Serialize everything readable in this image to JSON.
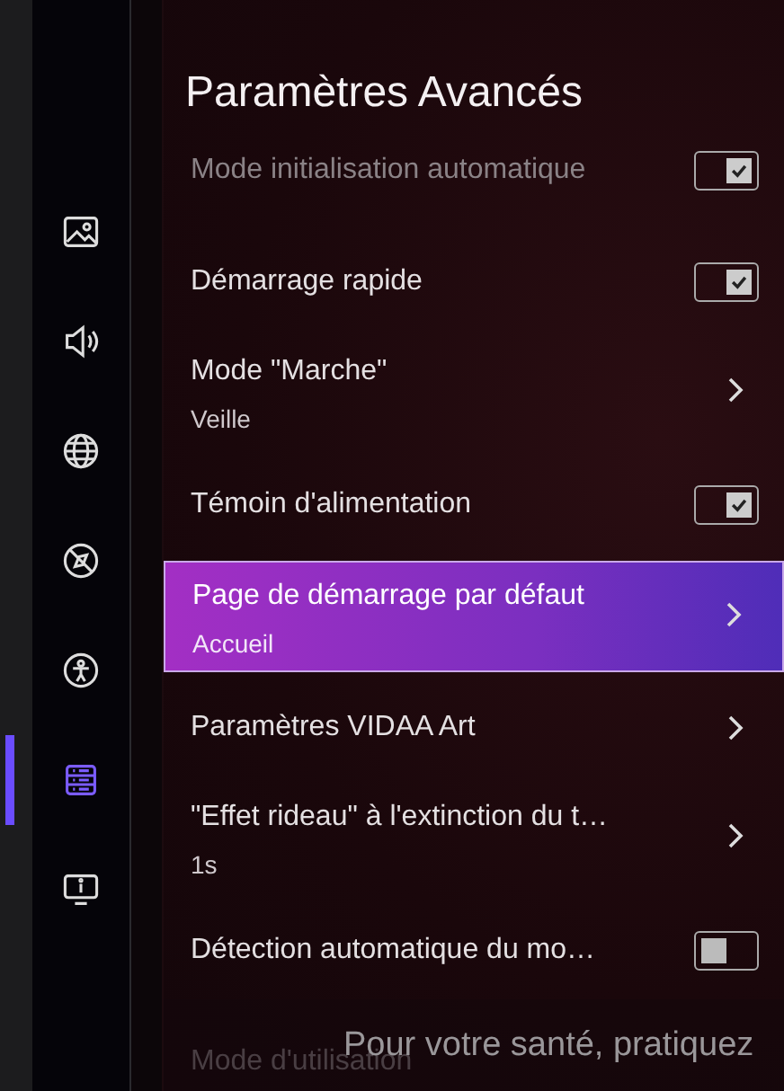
{
  "title": "Paramètres Avancés",
  "sidebar": [
    {
      "kind": "picture",
      "selected": false
    },
    {
      "kind": "sound",
      "selected": false
    },
    {
      "kind": "globe",
      "selected": false
    },
    {
      "kind": "block",
      "selected": false
    },
    {
      "kind": "person",
      "selected": false
    },
    {
      "kind": "list",
      "selected": true
    },
    {
      "kind": "monitor",
      "selected": false
    }
  ],
  "rows": [
    {
      "kind": "checkbox",
      "label": "Mode initialisation automatique",
      "checked": true,
      "dimmed": true,
      "selected": false
    },
    {
      "kind": "checkbox",
      "label": "Démarrage rapide",
      "checked": true,
      "dimmed": false,
      "selected": false
    },
    {
      "kind": "submenu",
      "label": "Mode \"Marche\"",
      "value": "Veille",
      "dimmed": false,
      "selected": false
    },
    {
      "kind": "checkbox",
      "label": "Témoin d'alimentation",
      "checked": true,
      "dimmed": false,
      "selected": false
    },
    {
      "kind": "submenu",
      "label": "Page de démarrage par défaut",
      "value": "Accueil",
      "dimmed": false,
      "selected": true
    },
    {
      "kind": "submenu",
      "label": "Paramètres VIDAA Art",
      "dimmed": false,
      "selected": false
    },
    {
      "kind": "submenu",
      "label": "\"Effet rideau\" à l'extinction du t…",
      "value": "1s",
      "dimmed": false,
      "selected": false
    },
    {
      "kind": "checkbox",
      "label": "Détection automatique du mo…",
      "checked": false,
      "dimmed": false,
      "selected": false
    },
    {
      "kind": "plain",
      "label": "Mode d'utilisation",
      "dimmed": true,
      "selected": false
    }
  ],
  "notice": "Pour votre santé, pratiquez"
}
